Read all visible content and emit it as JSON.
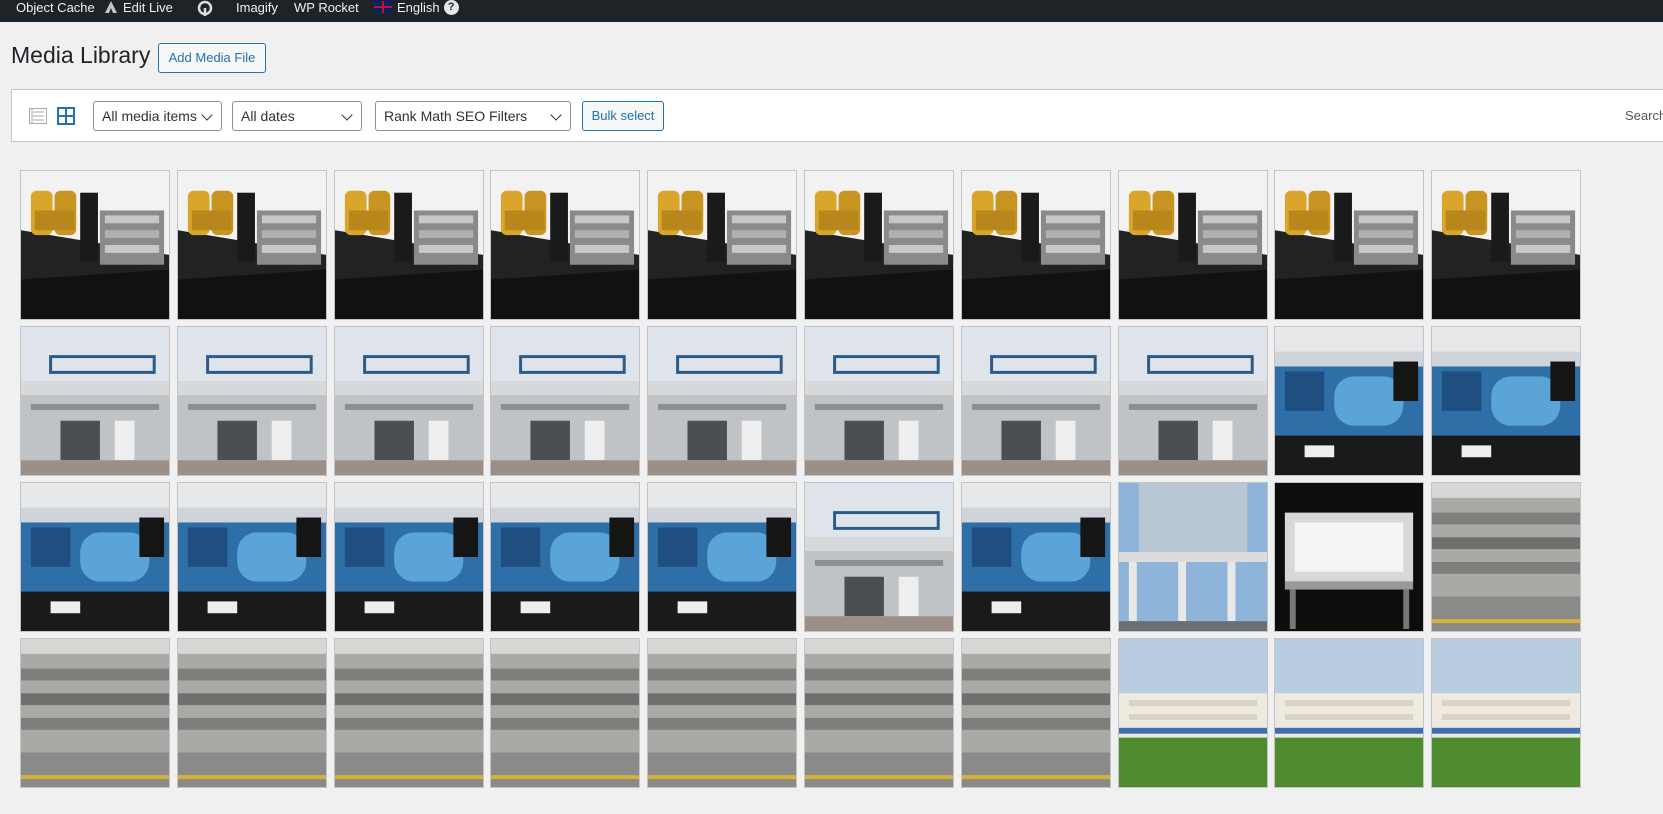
{
  "adminbar": {
    "items": [
      {
        "label": "Object Cache"
      },
      {
        "label": "Edit Live",
        "icon": "edit-live-icon"
      },
      {
        "label": "",
        "icon": "rank-math-icon"
      },
      {
        "label": "Imagify"
      },
      {
        "label": "WP Rocket"
      },
      {
        "label": "English",
        "icon": "uk-flag-icon"
      }
    ],
    "help": "?"
  },
  "header": {
    "title": "Media Library",
    "add_button": "Add Media File"
  },
  "toolbar": {
    "filters": [
      {
        "label": "All media items"
      },
      {
        "label": "All dates"
      },
      {
        "label": "Rank Math SEO Filters"
      }
    ],
    "bulk_select": "Bulk select",
    "search_label": "Search"
  },
  "colors": {
    "accent": "#2271b1",
    "adminbar_bg": "#1d2327",
    "page_bg": "#f0f0f1"
  },
  "media": {
    "rows": [
      [
        "generator",
        "generator",
        "generator",
        "generator",
        "generator",
        "generator",
        "generator",
        "generator",
        "generator",
        "generator"
      ],
      [
        "building",
        "building",
        "building",
        "building",
        "building",
        "building",
        "building",
        "building",
        "engine",
        "engine"
      ],
      [
        "engine",
        "engine",
        "engine",
        "engine",
        "engine",
        "building",
        "engine",
        "structure",
        "hall",
        "facility"
      ],
      [
        "facility",
        "facility",
        "facility",
        "facility",
        "facility",
        "facility",
        "facility",
        "containers",
        "containers",
        "containers"
      ]
    ]
  }
}
